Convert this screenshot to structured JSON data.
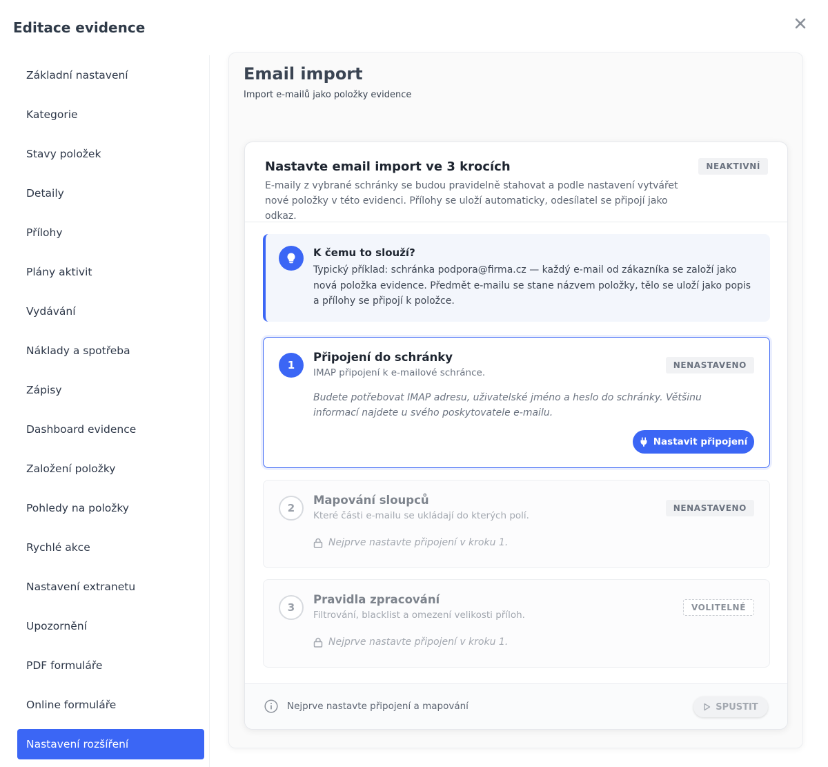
{
  "dialog": {
    "title": "Editace evidence",
    "close_icon": "close-icon"
  },
  "sidebar": {
    "items": [
      {
        "label": "Základní nastavení"
      },
      {
        "label": "Kategorie"
      },
      {
        "label": "Stavy položek"
      },
      {
        "label": "Detaily"
      },
      {
        "label": "Přílohy"
      },
      {
        "label": "Plány aktivit"
      },
      {
        "label": "Vydávání"
      },
      {
        "label": "Náklady a spotřeba"
      },
      {
        "label": "Zápisy"
      },
      {
        "label": "Dashboard evidence"
      },
      {
        "label": "Založení položky"
      },
      {
        "label": "Pohledy na položky"
      },
      {
        "label": "Rychlé akce"
      },
      {
        "label": "Nastavení extranetu"
      },
      {
        "label": "Upozornění"
      },
      {
        "label": "PDF formuláře"
      },
      {
        "label": "Online formuláře"
      },
      {
        "label": "Nastavení rozšíření",
        "active": true
      }
    ]
  },
  "main": {
    "title": "Email import",
    "subtitle": "Import e-mailů jako položky evidence"
  },
  "setup": {
    "title": "Nastavte email import ve 3 krocích",
    "description": "E-maily z vybrané schránky se budou pravidelně stahovat a podle nastavení vytvářet nové položky v této evidenci. Přílohy se uloží automaticky, odesílatel se připojí jako odkaz.",
    "status_badge": "NEAKTIVNÍ"
  },
  "info": {
    "icon": "lightbulb-icon",
    "title": "K čemu to slouží?",
    "text": "Typický příklad: schránka podpora@firma.cz — každý e-mail od zákazníka se založí jako nová položka evidence. Předmět e-mailu se stane názvem položky, tělo se uloží jako popis a přílohy se připojí k položce."
  },
  "steps": [
    {
      "number": "1",
      "title": "Připojení do schránky",
      "subtitle": "IMAP připojení k e-mailové schránce.",
      "badge": "NENASTAVENO",
      "note": "Budete potřebovat IMAP adresu, uživatelské jméno a heslo do schránky. Většinu informací najdete u svého poskytovatele e-mailu.",
      "button_label": "Nastavit připojení",
      "button_icon": "plug-icon"
    },
    {
      "number": "2",
      "title": "Mapování sloupců",
      "subtitle": "Které části e-mailu se ukládají do kterých polí.",
      "badge": "NENASTAVENO",
      "locked_text": "Nejprve nastavte připojení v kroku 1."
    },
    {
      "number": "3",
      "title": "Pravidla zpracování",
      "subtitle": "Filtrování, blacklist a omezení velikosti příloh.",
      "badge": "VOLITELNÉ",
      "locked_text": "Nejprve nastavte připojení v kroku 1."
    }
  ],
  "footer": {
    "message": "Nejprve nastavte připojení a mapování",
    "run_label": "SPUSTIT",
    "run_icon": "play-icon"
  },
  "colors": {
    "accent": "#3b66f5",
    "info_bg": "#f3f6fc"
  }
}
